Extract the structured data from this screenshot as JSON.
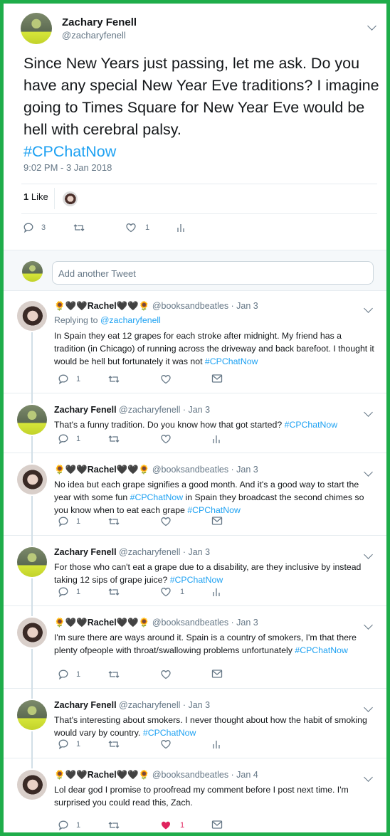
{
  "main": {
    "name": "Zachary Fenell",
    "handle": "@zacharyfenell",
    "text": "Since New Years just passing, let me ask. Do you have any special New Year Eve traditions? I imagine going to Times Square for New Year Eve would be hell with cerebral palsy.",
    "hashtag": "#CPChatNow",
    "timestamp": "9:02 PM - 3 Jan 2018",
    "likes_count": "1",
    "likes_label": "Like",
    "reply_count": "3",
    "like_count": "1"
  },
  "compose": {
    "placeholder": "Add another Tweet"
  },
  "replies": [
    {
      "name": "🌻🖤🖤Rachel🖤🖤🌻",
      "handle": "@booksandbeatles · Jan 3",
      "replying_to_prefix": "Replying to",
      "replying_to": "@zacharyfenell",
      "text": "In Spain they eat 12 grapes for each stroke after midnight. My friend has a tradition (in Chicago) of running across the driveway and back barefoot. I thought it would be hell but fortunately it was not",
      "tail": "",
      "hashtag": "#CPChatNow",
      "reply_count": "1",
      "like_count": "",
      "liked": false,
      "author": "rachel"
    },
    {
      "name": "Zachary Fenell",
      "handle": "@zacharyfenell · Jan 3",
      "text": "That's a funny tradition. Do you know how that got started?",
      "tail": "",
      "hashtag": "#CPChatNow",
      "reply_count": "1",
      "like_count": "",
      "liked": false,
      "author": "zach"
    },
    {
      "name": "🌻🖤🖤Rachel🖤🖤🌻",
      "handle": "@booksandbeatles · Jan 3",
      "text": "No idea but each grape signifies a good month. And it's a good way to start the year with some fun",
      "hashtag": "#CPChatNow",
      "tail": "in Spain they broadcast the second chimes so you know when to eat each grape",
      "hashtag2": "#CPChatNow",
      "reply_count": "1",
      "like_count": "",
      "liked": false,
      "author": "rachel"
    },
    {
      "name": "Zachary Fenell",
      "handle": "@zacharyfenell · Jan 3",
      "text": "For those who can't eat a grape due to a disability, are they inclusive by instead taking 12 sips of grape juice?",
      "tail": "",
      "hashtag": "#CPChatNow",
      "reply_count": "1",
      "like_count": "1",
      "liked": false,
      "author": "zach"
    },
    {
      "name": "🌻🖤🖤Rachel🖤🖤🌻",
      "handle": "@booksandbeatles · Jan 3",
      "text": "I'm sure there are ways around it. Spain is a country of smokers, I'm  that there plenty ofpeople with throat/swallowing problems unfortunately",
      "tail": "",
      "hashtag": "#CPChatNow",
      "reply_count": "1",
      "like_count": "",
      "liked": false,
      "author": "rachel"
    },
    {
      "name": "Zachary Fenell",
      "handle": "@zacharyfenell · Jan 3",
      "text": "That's interesting about smokers. I never thought about how the habit of smoking would vary by country.",
      "tail": "",
      "hashtag": "#CPChatNow",
      "reply_count": "1",
      "like_count": "",
      "liked": false,
      "author": "zach"
    },
    {
      "name": "🌻🖤🖤Rachel🖤🖤🌻",
      "handle": "@booksandbeatles · Jan 4",
      "text": "Lol dear god I promise to proofread my comment before I post next time. I'm surprised you could read this, Zach.",
      "tail": "",
      "hashtag": "",
      "reply_count": "1",
      "like_count": "1",
      "liked": true,
      "author": "rachel"
    }
  ],
  "colors": {
    "border": "#1fad4a",
    "link": "#1da1f2",
    "liked": "#e0245e",
    "muted": "#657786"
  },
  "icons": [
    "reply-icon",
    "retweet-icon",
    "like-icon",
    "analytics-icon",
    "message-icon",
    "chevron-down-icon"
  ]
}
